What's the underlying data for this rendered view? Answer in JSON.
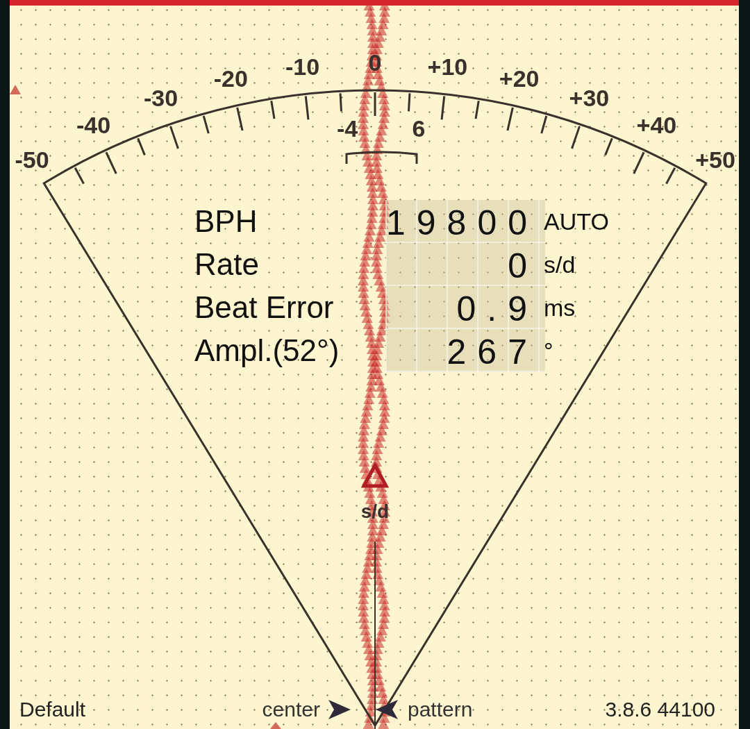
{
  "dial": {
    "scale_labels": [
      "-50",
      "-40",
      "-30",
      "-20",
      "-10",
      "0",
      "+10",
      "+20",
      "+30",
      "+40",
      "+50"
    ],
    "inner_labels": [
      "-4",
      "6"
    ],
    "marker_label": "s/d"
  },
  "readout": [
    {
      "label": "BPH",
      "value": "19800",
      "unit": "AUTO"
    },
    {
      "label": "Rate",
      "value": "0",
      "unit": "s/d"
    },
    {
      "label": "Beat Error",
      "value": "0.9",
      "unit": "ms"
    },
    {
      "label": "Ampl.(52°)",
      "value": "267",
      "unit": "°"
    }
  ],
  "footer": {
    "left": "Default",
    "center": "center",
    "pattern": "pattern",
    "right": "3.8.6 44100"
  }
}
